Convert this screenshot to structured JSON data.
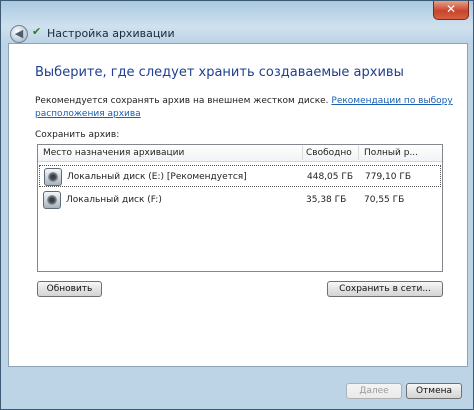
{
  "window": {
    "title": "Настройка архивации",
    "close_glyph": "✕",
    "back_glyph": "◀"
  },
  "content": {
    "heading": "Выберите, где следует хранить создаваемые архивы",
    "recommendation_text": "Рекомендуется сохранять архив на внешнем жестком диске. ",
    "recommendation_link": "Рекомендации по выбору расположения архива",
    "save_label": "Сохранить архив:"
  },
  "list": {
    "columns": [
      "Место назначения архивации",
      "Свободно",
      "Полный р..."
    ],
    "rows": [
      {
        "name": "Локальный диск (E:) [Рекомендуется]",
        "free": "448,05 ГБ",
        "total": "779,10 ГБ",
        "selected": true
      },
      {
        "name": "Локальный диск (F:)",
        "free": "35,38 ГБ",
        "total": "70,55 ГБ",
        "selected": false
      }
    ]
  },
  "buttons": {
    "refresh": "Обновить",
    "save_network": "Сохранить в сети...",
    "next": "Далее",
    "cancel": "Отмена"
  },
  "colors": {
    "heading": "#1f3f8f",
    "link": "#1a5fb4",
    "frame": "#bcd4e6"
  }
}
